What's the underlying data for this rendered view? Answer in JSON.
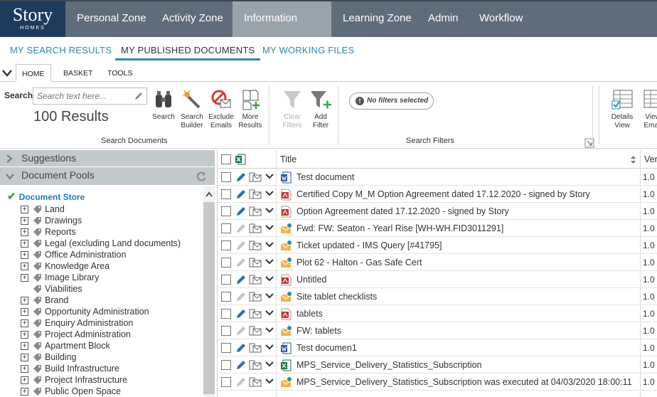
{
  "brand": {
    "line1": "Story",
    "line2": "HOMES"
  },
  "nav": [
    "Personal Zone",
    "Activity Zone",
    "Information Zone",
    "Learning Zone",
    "Admin",
    "Workflow"
  ],
  "subtabs": [
    "MY SEARCH RESULTS",
    "MY PUBLISHED DOCUMENTS",
    "MY WORKING FILES"
  ],
  "ribbon_tabs": [
    "HOME",
    "BASKET",
    "TOOLS"
  ],
  "search": {
    "label": "Search",
    "placeholder": "Search text here...",
    "results": "100 Results"
  },
  "groups": {
    "search_documents": "Search Documents",
    "search_filters": "Search Filters"
  },
  "buttons": {
    "search": "Search",
    "search_builder": [
      "Search",
      "Builder"
    ],
    "exclude_emails": [
      "Exclude",
      "Emails"
    ],
    "more_results": [
      "More",
      "Results"
    ],
    "clear_filters": [
      "Clear",
      "Filters"
    ],
    "add_filter": [
      "Add",
      "Filter"
    ],
    "details_view": [
      "Details",
      "View"
    ],
    "view_email": [
      "View",
      "Email"
    ]
  },
  "filter_badge": "No filters selected",
  "left": {
    "suggestions": "Suggestions",
    "pools": "Document Pools",
    "root": "Document Store",
    "items": [
      {
        "label": "Land",
        "expand": true
      },
      {
        "label": "Drawings",
        "expand": true
      },
      {
        "label": "Reports",
        "expand": true
      },
      {
        "label": "Legal (excluding Land documents)",
        "expand": true
      },
      {
        "label": "Office Administration",
        "expand": true
      },
      {
        "label": "Knowledge Area",
        "expand": true
      },
      {
        "label": "Image Library",
        "expand": true
      },
      {
        "label": "Viabilities",
        "expand": false
      },
      {
        "label": "Brand",
        "expand": true
      },
      {
        "label": "Opportunity Administration",
        "expand": true
      },
      {
        "label": "Enquiry Administration",
        "expand": true
      },
      {
        "label": "Project Administration",
        "expand": true
      },
      {
        "label": "Apartment Block",
        "expand": true
      },
      {
        "label": "Building",
        "expand": true
      },
      {
        "label": "Build Infrastructure",
        "expand": true
      },
      {
        "label": "Project Infrastructure",
        "expand": true
      },
      {
        "label": "Public Open Space",
        "expand": true
      }
    ]
  },
  "grid": {
    "col_title": "Title",
    "col_version": "Ver",
    "rows": [
      {
        "title": "Test document",
        "type": "word",
        "ver": "1.0",
        "editable": true
      },
      {
        "title": "Certified Copy M_M Option Agreement dated 17.12.2020 - signed by Story",
        "type": "pdf",
        "ver": "1.0",
        "editable": true
      },
      {
        "title": "Option Agreement dated 17.12.2020 - signed by Story",
        "type": "pdf",
        "ver": "1.0",
        "editable": true
      },
      {
        "title": "Fwd: FW: Seaton - Yearl Rise [WH-WH.FID3011291]",
        "type": "email",
        "ver": "1.0",
        "editable": false
      },
      {
        "title": "Ticket updated - IMS Query [#41795]",
        "type": "email",
        "ver": "1.0",
        "editable": false
      },
      {
        "title": "Plot 62 - Halton - Gas Safe Cert",
        "type": "email",
        "ver": "1.0",
        "editable": false
      },
      {
        "title": "Untitled",
        "type": "pdf",
        "ver": "1.0",
        "editable": true
      },
      {
        "title": "Site tablet checklists",
        "type": "email",
        "ver": "1.0",
        "editable": false
      },
      {
        "title": "tablets",
        "type": "pdf",
        "ver": "1.0",
        "editable": true
      },
      {
        "title": "FW: tablets",
        "type": "email",
        "ver": "1.0",
        "editable": false
      },
      {
        "title": "Test documen1",
        "type": "word",
        "ver": "1.0",
        "editable": true
      },
      {
        "title": "MPS_Service_Delivery_Statistics_Subscription",
        "type": "excel",
        "ver": "1.0",
        "editable": true
      },
      {
        "title": "MPS_Service_Delivery_Statistics_Subscription was executed at 04/03/2020 18:00:11",
        "type": "email",
        "ver": "1.0",
        "editable": false
      }
    ]
  },
  "colors": {
    "accent": "#2a89b8",
    "nav_bg": "#5f6d7a",
    "logo_bg": "#1d3b5d",
    "active_nav": "#98a3ac"
  }
}
